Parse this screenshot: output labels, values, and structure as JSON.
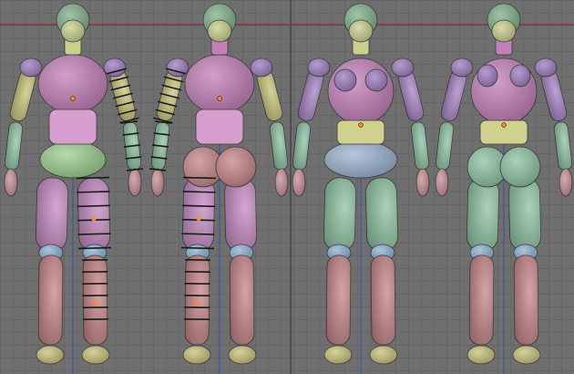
{
  "viewport": {
    "background": "#6f6f6f",
    "grid_color": "#5d5d5d",
    "horizon_color": "#8a2d2d",
    "axis_color": "#2f4fb0"
  },
  "palette": {
    "head": "#7fb08a",
    "head_shadow": "#5f8d6d",
    "neck_yellow": "#c9d08d",
    "torso_pink": "#c27fb8",
    "torso_pink_light": "#d79fcf",
    "arm_violet": "#a883c6",
    "arm_yellow": "#c9c47a",
    "forearm_teal": "#8fc2a4",
    "hand_pink": "#c98f96",
    "pelvis_green": "#9ccf8f",
    "hip_blue": "#9bb4cf",
    "thigh_teal": "#8ec3a2",
    "thigh_pink": "#c48ac1",
    "knee_blue": "#8fb1d4",
    "shin_salmon": "#c58588",
    "foot_yellow": "#c9c17a",
    "waist_yellow": "#cfd18c",
    "breast_violet": "#9f7dc0",
    "ring_black": "#1a1a1a",
    "bone_orange": "#ff8a2c"
  },
  "figures": [
    {
      "name": "front-view-selected-bones"
    },
    {
      "name": "back-view-selected-bones"
    },
    {
      "name": "front-view"
    },
    {
      "name": "back-view"
    }
  ]
}
